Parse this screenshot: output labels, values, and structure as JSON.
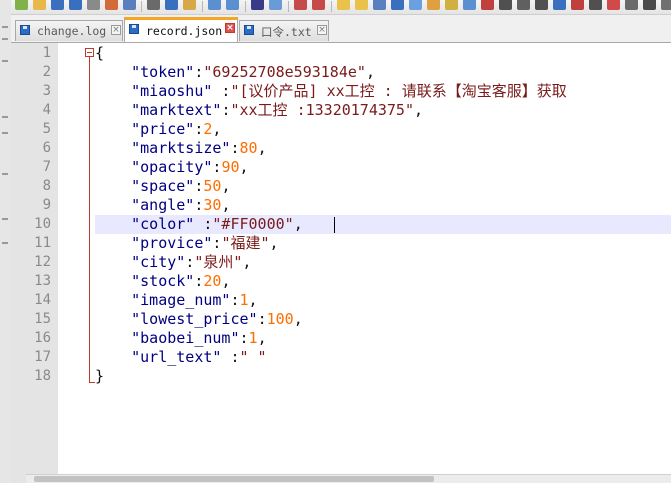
{
  "tabs": [
    {
      "label": "change.log",
      "close": "×"
    },
    {
      "label": "record.json",
      "close": "×"
    },
    {
      "label": "口令.txt",
      "close": "×"
    }
  ],
  "editor": {
    "line_numbers": [
      "1",
      "2",
      "3",
      "4",
      "5",
      "6",
      "7",
      "8",
      "9",
      "10",
      "11",
      "12",
      "13",
      "14",
      "15",
      "16",
      "17",
      "18"
    ],
    "lines": [
      "{",
      "    \"token\":\"69252708e593184e\",",
      "    \"miaoshu\" :\"[议价产品] xx工控 : 请联系【淘宝客服】获取",
      "    \"marktext\":\"xx工控 :13320174375\",",
      "    \"price\":2,",
      "    \"marktsize\":80,",
      "    \"opacity\":90,",
      "    \"space\":50,",
      "    \"angle\":30,",
      "    \"color\" :\"#FF0000\",",
      "    \"provice\":\"福建\",",
      "    \"city\":\"泉州\",",
      "    \"stock\":20,",
      "    \"image_num\":1,",
      "    \"lowest_price\":100,",
      "    \"baobei_num\":1,",
      "    \"url_text\" :\" \"",
      "}"
    ],
    "current_line": 10
  },
  "colors": {
    "key": "#000080",
    "number": "#ff6d00",
    "string": "#7a1b1b",
    "active_tab_accent": "#f6a623",
    "current_line_bg": "#e8e8ff"
  }
}
